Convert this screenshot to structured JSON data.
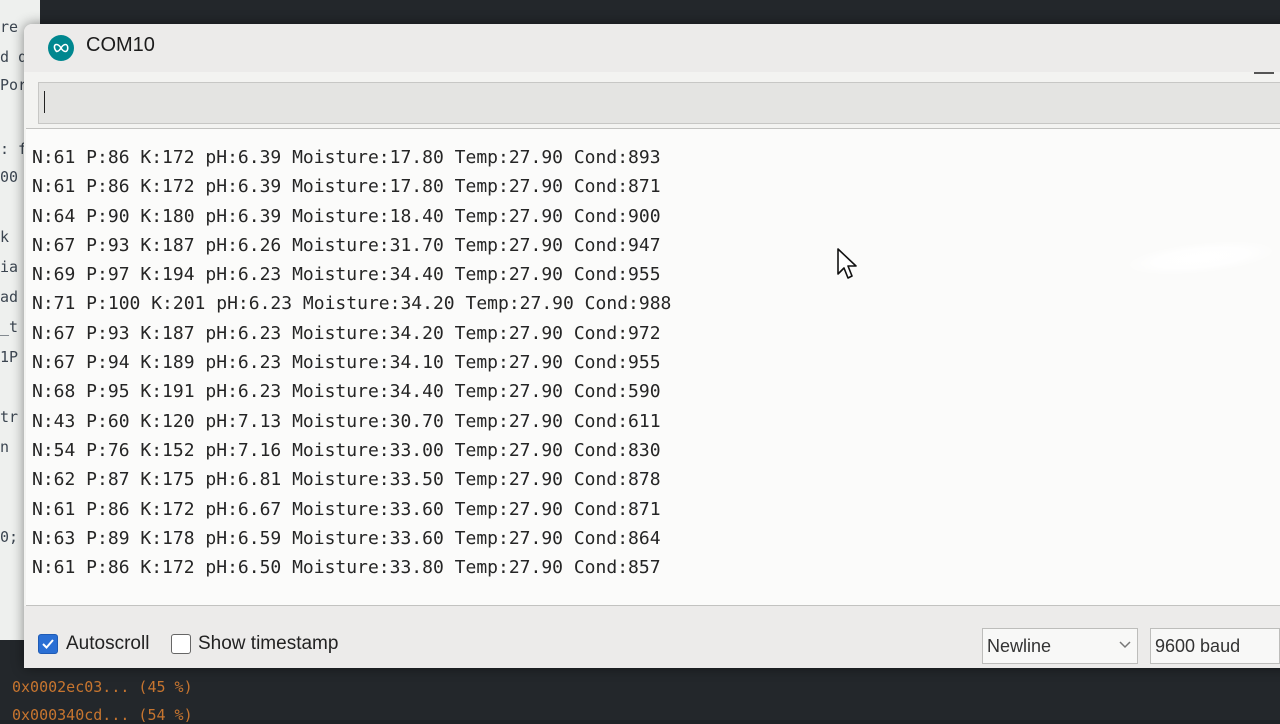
{
  "background": {
    "code_fragments": [
      "re",
      "d q",
      "Por",
      ": f",
      "00",
      "k",
      "ia",
      "ad",
      "_t",
      "1P",
      "tr",
      "n",
      "0;"
    ],
    "console_lines": [
      "0x0002ec03... (45 %)",
      "0x000340cd... (54 %)"
    ]
  },
  "window": {
    "title": "COM10",
    "app_icon": "arduino-infinity-icon"
  },
  "send": {
    "value": "",
    "placeholder": ""
  },
  "output": {
    "lines": [
      "N:61 P:86 K:172 pH:6.39 Moisture:17.80 Temp:27.90 Cond:893",
      "N:61 P:86 K:172 pH:6.39 Moisture:17.80 Temp:27.90 Cond:871",
      "N:64 P:90 K:180 pH:6.39 Moisture:18.40 Temp:27.90 Cond:900",
      "N:67 P:93 K:187 pH:6.26 Moisture:31.70 Temp:27.90 Cond:947",
      "N:69 P:97 K:194 pH:6.23 Moisture:34.40 Temp:27.90 Cond:955",
      "N:71 P:100 K:201 pH:6.23 Moisture:34.20 Temp:27.90 Cond:988",
      "N:67 P:93 K:187 pH:6.23 Moisture:34.20 Temp:27.90 Cond:972",
      "N:67 P:94 K:189 pH:6.23 Moisture:34.10 Temp:27.90 Cond:955",
      "N:68 P:95 K:191 pH:6.23 Moisture:34.40 Temp:27.90 Cond:590",
      "N:43 P:60 K:120 pH:7.13 Moisture:30.70 Temp:27.90 Cond:611",
      "N:54 P:76 K:152 pH:7.16 Moisture:33.00 Temp:27.90 Cond:830",
      "N:62 P:87 K:175 pH:6.81 Moisture:33.50 Temp:27.90 Cond:878",
      "N:61 P:86 K:172 pH:6.67 Moisture:33.60 Temp:27.90 Cond:871",
      "N:63 P:89 K:178 pH:6.59 Moisture:33.60 Temp:27.90 Cond:864",
      "N:61 P:86 K:172 pH:6.50 Moisture:33.80 Temp:27.90 Cond:857"
    ]
  },
  "footer": {
    "autoscroll_label": "Autoscroll",
    "autoscroll_checked": true,
    "timestamp_label": "Show timestamp",
    "timestamp_checked": false,
    "line_ending": "Newline",
    "baud_rate": "9600 baud"
  },
  "colors": {
    "accent": "#2a6fd4",
    "arduino_teal": "#00878f"
  }
}
